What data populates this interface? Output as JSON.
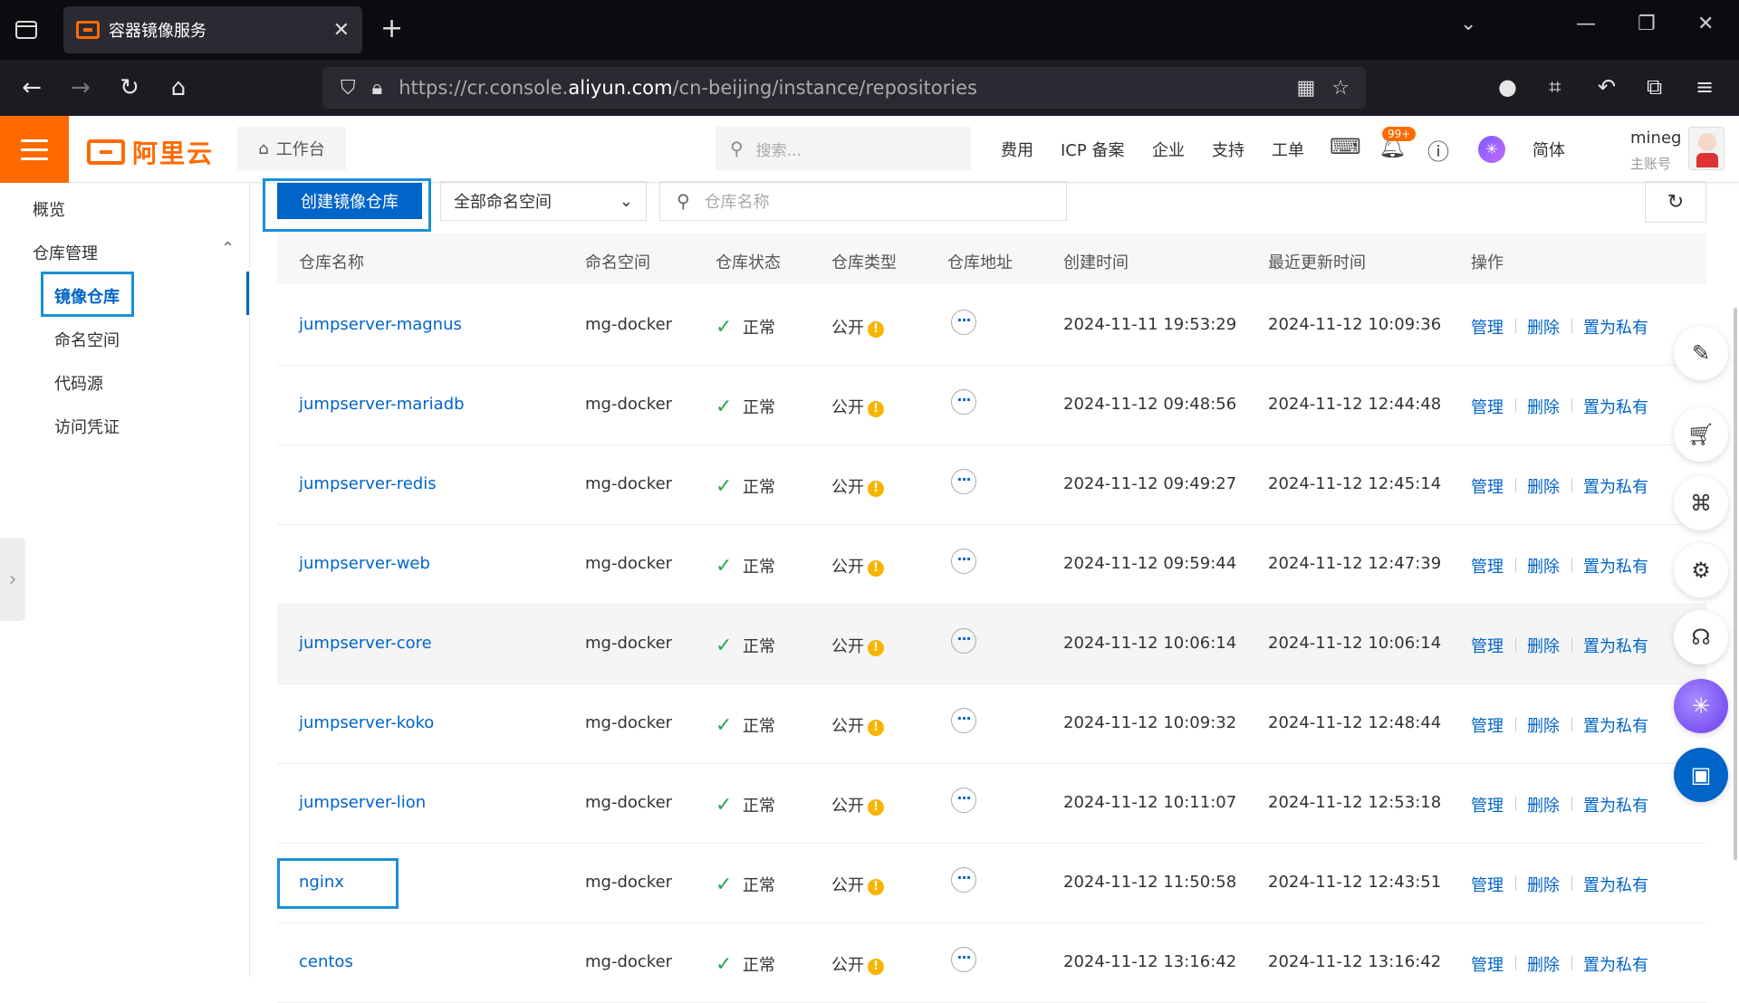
{
  "browser": {
    "tab_title": "容器镜像服务",
    "url_prefix": "https://cr.console.",
    "url_domain": "aliyun.com",
    "url_path": "/cn-beijing/instance/repositories"
  },
  "topbar": {
    "logo_text": "阿里云",
    "workbench": "工作台",
    "search_placeholder": "搜索...",
    "links": [
      "费用",
      "ICP 备案",
      "企业",
      "支持",
      "工单"
    ],
    "notification_badge": "99+",
    "language": "简体",
    "user_name": "mineg",
    "user_type": "主账号"
  },
  "sidebar": {
    "overview": "概览",
    "group": "仓库管理",
    "items": [
      "镜像仓库",
      "命名空间",
      "代码源",
      "访问凭证"
    ]
  },
  "toolbar": {
    "create_button": "创建镜像仓库",
    "namespace_select": "全部命名空间",
    "search_placeholder": "仓库名称"
  },
  "table": {
    "headers": [
      "仓库名称",
      "命名空间",
      "仓库状态",
      "仓库类型",
      "仓库地址",
      "创建时间",
      "最近更新时间",
      "操作"
    ],
    "actions": [
      "管理",
      "删除",
      "置为私有"
    ],
    "rows": [
      {
        "name": "jumpserver-magnus",
        "namespace": "mg-docker",
        "status": "正常",
        "type": "公开",
        "created": "2024-11-11 19:53:29",
        "updated": "2024-11-12 10:09:36"
      },
      {
        "name": "jumpserver-mariadb",
        "namespace": "mg-docker",
        "status": "正常",
        "type": "公开",
        "created": "2024-11-12 09:48:56",
        "updated": "2024-11-12 12:44:48"
      },
      {
        "name": "jumpserver-redis",
        "namespace": "mg-docker",
        "status": "正常",
        "type": "公开",
        "created": "2024-11-12 09:49:27",
        "updated": "2024-11-12 12:45:14"
      },
      {
        "name": "jumpserver-web",
        "namespace": "mg-docker",
        "status": "正常",
        "type": "公开",
        "created": "2024-11-12 09:59:44",
        "updated": "2024-11-12 12:47:39"
      },
      {
        "name": "jumpserver-core",
        "namespace": "mg-docker",
        "status": "正常",
        "type": "公开",
        "created": "2024-11-12 10:06:14",
        "updated": "2024-11-12 10:06:14"
      },
      {
        "name": "jumpserver-koko",
        "namespace": "mg-docker",
        "status": "正常",
        "type": "公开",
        "created": "2024-11-12 10:09:32",
        "updated": "2024-11-12 12:48:44"
      },
      {
        "name": "jumpserver-lion",
        "namespace": "mg-docker",
        "status": "正常",
        "type": "公开",
        "created": "2024-11-12 10:11:07",
        "updated": "2024-11-12 12:53:18"
      },
      {
        "name": "nginx",
        "namespace": "mg-docker",
        "status": "正常",
        "type": "公开",
        "created": "2024-11-12 11:50:58",
        "updated": "2024-11-12 12:43:51"
      },
      {
        "name": "centos",
        "namespace": "mg-docker",
        "status": "正常",
        "type": "公开",
        "created": "2024-11-12 13:16:42",
        "updated": "2024-11-12 13:16:42"
      }
    ]
  },
  "colors": {
    "brand_orange": "#ff6a00",
    "primary_blue": "#0064c8",
    "success_green": "#2aa84a",
    "warning_yellow": "#f7b500"
  }
}
